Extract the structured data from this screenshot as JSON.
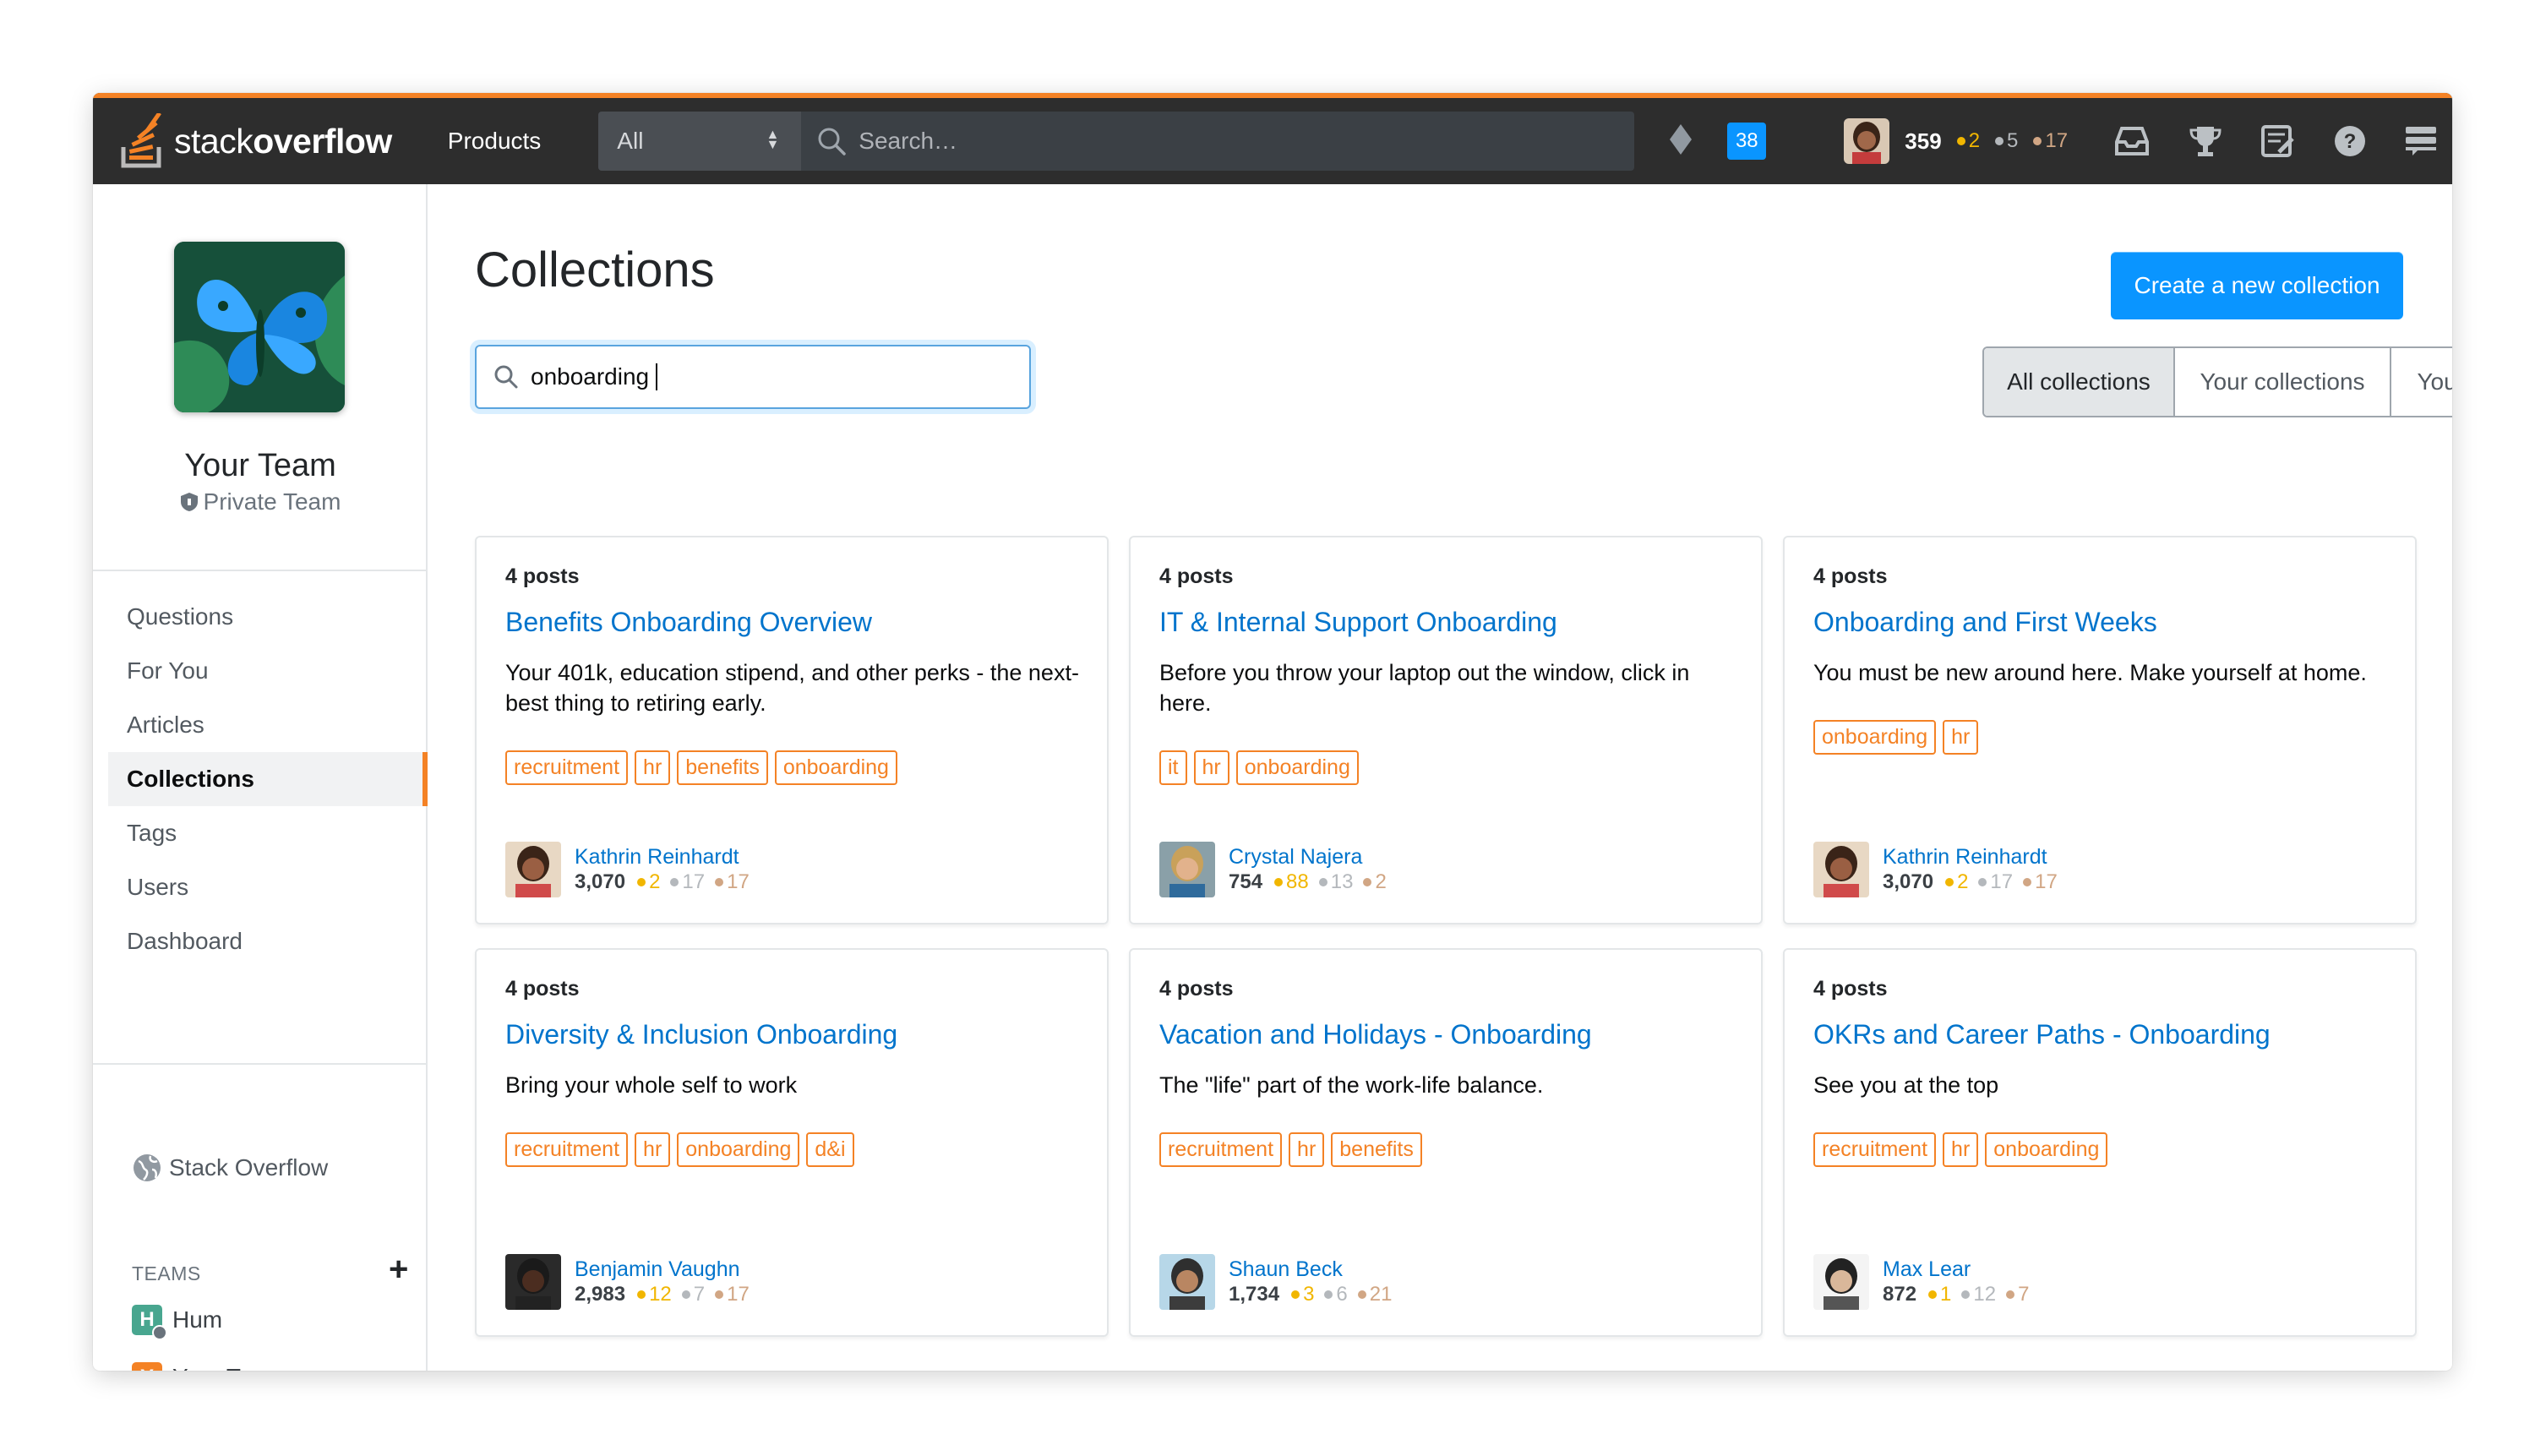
{
  "topbar": {
    "logo_text_light": "stack",
    "logo_text_bold": "overflow",
    "products_label": "Products",
    "scope_value": "All",
    "search_placeholder": "Search…",
    "inbox_count": "38",
    "user": {
      "reputation": "359",
      "gold": "2",
      "silver": "5",
      "bronze": "17"
    },
    "icons": [
      "achievements-diamond-icon",
      "inbox-icon",
      "trophy-icon",
      "review-icon",
      "help-icon",
      "site-switcher-icon"
    ]
  },
  "sidebar": {
    "team_name": "Your Team",
    "team_visibility": "Private Team",
    "nav": [
      {
        "label": "Questions"
      },
      {
        "label": "For You"
      },
      {
        "label": "Articles"
      },
      {
        "label": "Collections",
        "active": true
      },
      {
        "label": "Tags"
      },
      {
        "label": "Users"
      },
      {
        "label": "Dashboard"
      }
    ],
    "public_site": "Stack Overflow",
    "teams_heading": "TEAMS",
    "teams": [
      {
        "letter": "H",
        "name": "Hum",
        "color": "#48a68f"
      },
      {
        "letter": "Y",
        "name": "Your Team",
        "color": "#f48225"
      }
    ]
  },
  "main": {
    "title": "Collections",
    "create_button": "Create a new collection",
    "filter_value": "onboarding",
    "tabs": [
      "All collections",
      "Your collections",
      "You can edit"
    ],
    "cards": [
      {
        "posts": "4 posts",
        "title": "Benefits Onboarding Overview",
        "description": "Your 401k, education stipend, and other perks - the next-best thing to retiring early.",
        "tags": [
          "recruitment",
          "hr",
          "benefits",
          "onboarding"
        ],
        "owner": "Kathrin Reinhardt",
        "rep": "3,070",
        "gold": "2",
        "silver": "17",
        "bronze": "17"
      },
      {
        "posts": "4 posts",
        "title": "IT & Internal Support Onboarding",
        "description": "Before you throw your laptop out the window, click in here.",
        "tags": [
          "it",
          "hr",
          "onboarding"
        ],
        "owner": "Crystal Najera",
        "rep": "754",
        "gold": "88",
        "silver": "13",
        "bronze": "2"
      },
      {
        "posts": "4 posts",
        "title": "Onboarding and First Weeks",
        "description": "You must be new around here. Make yourself at home.",
        "tags": [
          "onboarding",
          "hr"
        ],
        "owner": "Kathrin Reinhardt",
        "rep": "3,070",
        "gold": "2",
        "silver": "17",
        "bronze": "17"
      },
      {
        "posts": "4 posts",
        "title": "Diversity & Inclusion Onboarding",
        "description": "Bring your whole self to work",
        "tags": [
          "recruitment",
          "hr",
          "onboarding",
          "d&i"
        ],
        "owner": "Benjamin Vaughn",
        "rep": "2,983",
        "gold": "12",
        "silver": "7",
        "bronze": "17"
      },
      {
        "posts": "4 posts",
        "title": "Vacation and Holidays - Onboarding",
        "description": "The \"life\" part of the work-life balance.",
        "tags": [
          "recruitment",
          "hr",
          "benefits"
        ],
        "owner": "Shaun Beck",
        "rep": "1,734",
        "gold": "3",
        "silver": "6",
        "bronze": "21"
      },
      {
        "posts": "4 posts",
        "title": "OKRs and Career Paths - Onboarding",
        "description": "See you at the top",
        "tags": [
          "recruitment",
          "hr",
          "onboarding"
        ],
        "owner": "Max Lear",
        "rep": "872",
        "gold": "1",
        "silver": "12",
        "bronze": "7"
      }
    ]
  },
  "colors": {
    "accent": "#f48225",
    "link": "#0074cc",
    "primary_button": "#0a95ff",
    "topbar": "#2d2d2d"
  }
}
